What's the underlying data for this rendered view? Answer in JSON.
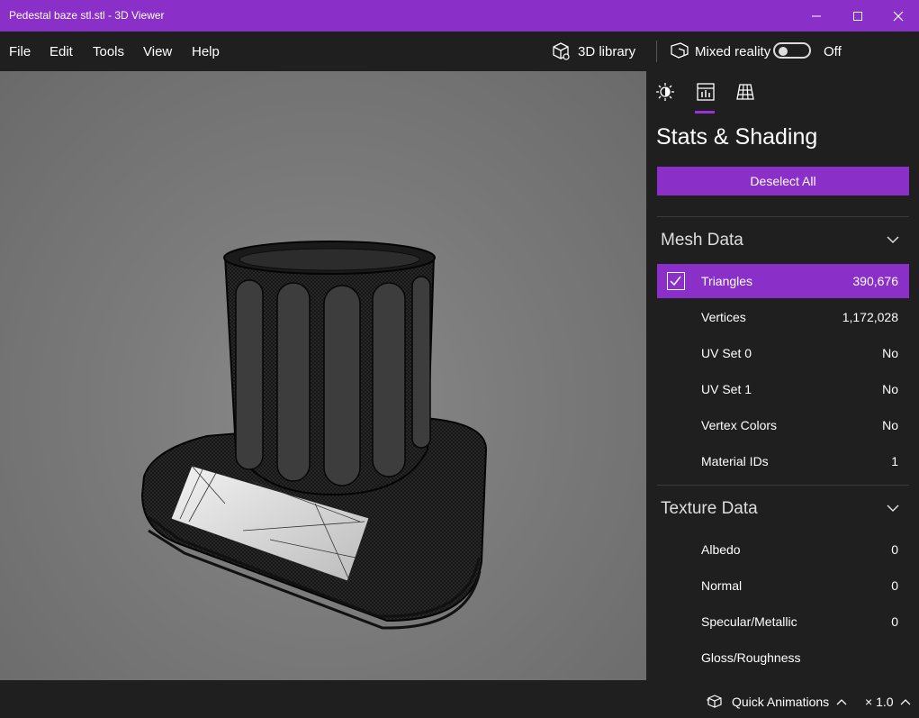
{
  "window": {
    "title": "Pedestal baze stl.stl - 3D Viewer",
    "accent_color": "#8b2fc9"
  },
  "menu": {
    "items": [
      "File",
      "Edit",
      "Tools",
      "View",
      "Help"
    ],
    "library_label": "3D library",
    "mixed_reality_label": "Mixed reality",
    "mixed_reality_state": "Off"
  },
  "panel": {
    "tabs": [
      "lighting-icon",
      "stats-icon",
      "grid-icon"
    ],
    "active_tab": "stats-icon",
    "title": "Stats & Shading",
    "deselect_label": "Deselect All",
    "mesh_section": {
      "title": "Mesh Data",
      "rows": [
        {
          "label": "Triangles",
          "value": "390,676",
          "selected": true
        },
        {
          "label": "Vertices",
          "value": "1,172,028"
        },
        {
          "label": "UV Set 0",
          "value": "No"
        },
        {
          "label": "UV Set 1",
          "value": "No"
        },
        {
          "label": "Vertex Colors",
          "value": "No"
        },
        {
          "label": "Material IDs",
          "value": "1"
        }
      ]
    },
    "texture_section": {
      "title": "Texture Data",
      "rows": [
        {
          "label": "Albedo",
          "value": "0"
        },
        {
          "label": "Normal",
          "value": "0"
        },
        {
          "label": "Specular/Metallic",
          "value": "0"
        },
        {
          "label": "Gloss/Roughness",
          "value": ""
        }
      ]
    }
  },
  "status": {
    "animations_label": "Quick Animations",
    "speed": "× 1.0"
  }
}
